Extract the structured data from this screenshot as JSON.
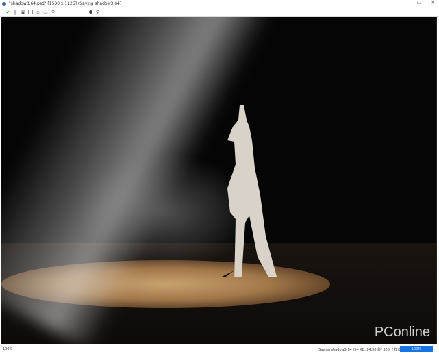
{
  "window": {
    "title": "\"shadow3.64.psd\" [1500 x 1125] (Saving shadow3.64)",
    "minimize": "–",
    "maximize": "☐",
    "close": "✕"
  },
  "toolbar": {
    "icons": [
      "check-icon",
      "pause-icon",
      "save-icon",
      "crop-icon",
      "fit-icon",
      "grid-icon",
      "zoom-out-icon",
      "zoom-slider",
      "zoom-in-icon"
    ],
    "zoom_level": 1.0
  },
  "canvas": {
    "watermark": "PConline"
  },
  "status": {
    "zoom": "100%",
    "message": "Saving shadow3.64 (54 KB, 14.98 秒/ 300 个样本)",
    "progress_label": "100%",
    "progress": 1.0,
    "progress_color": "#1874e0"
  }
}
